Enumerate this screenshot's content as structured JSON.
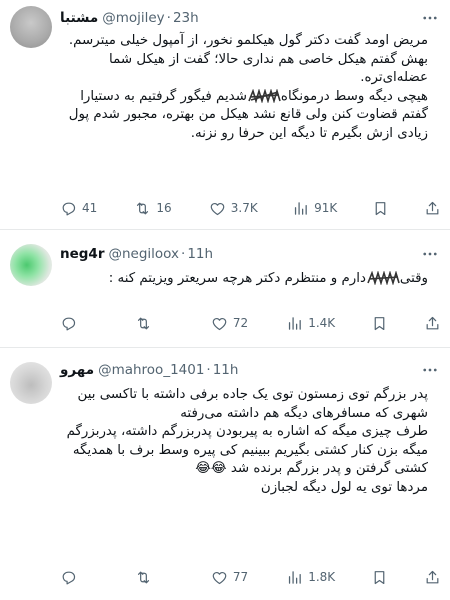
{
  "tweets": [
    {
      "author": {
        "name": "مشتبا",
        "handle": "@mojiley",
        "time": "23h"
      },
      "body": [
        "مریض اومد گفت دکتر گول هیکلمو نخور، از آمپول خیلی میترسم. بهش گفتم هیکل خاصی هم نداری حالا؛ گفت از هیکل شما عضله‌ای‌تره.",
        "هیچی دیگه وسط درمونگاه",
        "شدیم فیگور گرفتیم به دستیارا گفتم قضاوت کنن ولی قانع نشد هیکل من بهتره، مجبور شدم پول زیادی ازش بگیرم تا دیگه این حرفا رو نزنه."
      ],
      "stats": {
        "replies": "41",
        "reposts": "16",
        "likes": "3.7K",
        "views": "91K"
      }
    },
    {
      "author": {
        "name": "neg4r",
        "handle": "@negiloox",
        "time": "11h"
      },
      "body": [
        "وقتی",
        "دارم و منتظرم دکتر هرچه سریعتر ویزیتم کنه :"
      ],
      "stats": {
        "replies": "",
        "reposts": "",
        "likes": "72",
        "views": "1.4K"
      }
    },
    {
      "author": {
        "name": "مهرو",
        "handle": "@mahroo_1401",
        "time": "11h"
      },
      "body": [
        "پدر بزرگم توی زمستون توی یک جاده برفی داشته با تاکسی بین شهری که مسافرهای دیگه هم داشته می‌رفته",
        "طرف چیزی میگه که اشاره به پیربودن پدربزرگم داشته، پدربزرگم میگه بزن کنار کشتی بگیریم ببینیم کی پیره وسط برف با همدیگه کشتی گرفتن و پدر بزرگم برنده شد",
        "😂😂",
        "مردها توی یه لول دیگه لجبازن"
      ],
      "stats": {
        "replies": "",
        "reposts": "",
        "likes": "77",
        "views": "1.8K"
      }
    }
  ],
  "icons": {
    "more": "more-horizontal-icon",
    "reply": "reply-bubble-icon",
    "repost": "repost-icon",
    "like": "heart-icon",
    "views": "analytics-bars-icon",
    "bookmark": "bookmark-icon",
    "share": "share-icon"
  },
  "colors": {
    "text": "#0f1419",
    "secondary": "#536471",
    "divider": "#e7e9ea"
  }
}
